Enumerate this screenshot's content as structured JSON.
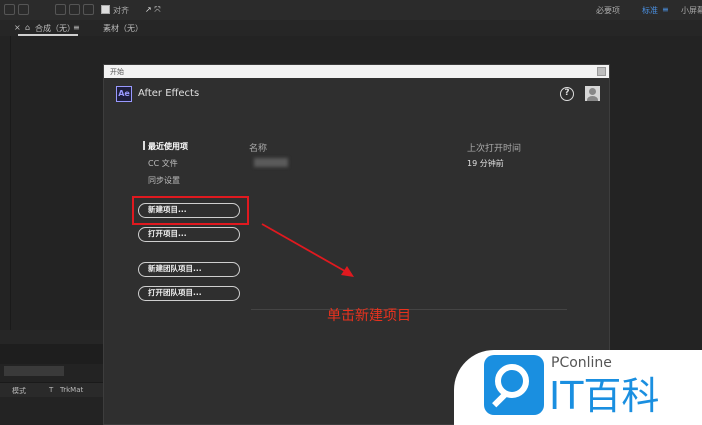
{
  "toolbar": {
    "snap_label": "对齐",
    "workspace_essentials": "必要项",
    "workspace_standard": "标准",
    "workspace_small": "小屏幕"
  },
  "tabs": {
    "composition": "合成（无）",
    "footage": "素材（无）",
    "menu_glyph": "≡",
    "close_glyph": "×"
  },
  "timeline": {
    "mode_label": "模式",
    "t_label": "T",
    "trkmat_label": "TrkMat"
  },
  "dialog": {
    "title": "开始",
    "app_name": "After Effects",
    "logo_text": "Ae",
    "help_glyph": "?",
    "nav": [
      "最近使用项",
      "CC 文件",
      "同步设置"
    ],
    "columns": {
      "name": "名称",
      "last_opened": "上次打开时间"
    },
    "recent": [
      {
        "last_opened": "19 分钟前"
      }
    ],
    "buttons": {
      "new_project": "新建项目...",
      "open_project": "打开项目...",
      "new_team_project": "新建团队项目...",
      "open_team_project": "打开团队项目..."
    }
  },
  "annotation": {
    "text": "单击新建项目",
    "color": "#e8321e"
  },
  "watermark": {
    "brand_small": "PConline",
    "brand_large": "IT百科",
    "color": "#1a8fe0"
  },
  "colors": {
    "background": "#232323",
    "dialog": "#2f2f2f",
    "highlight_box": "#e0191f",
    "accent_blue": "#4a90e2"
  }
}
